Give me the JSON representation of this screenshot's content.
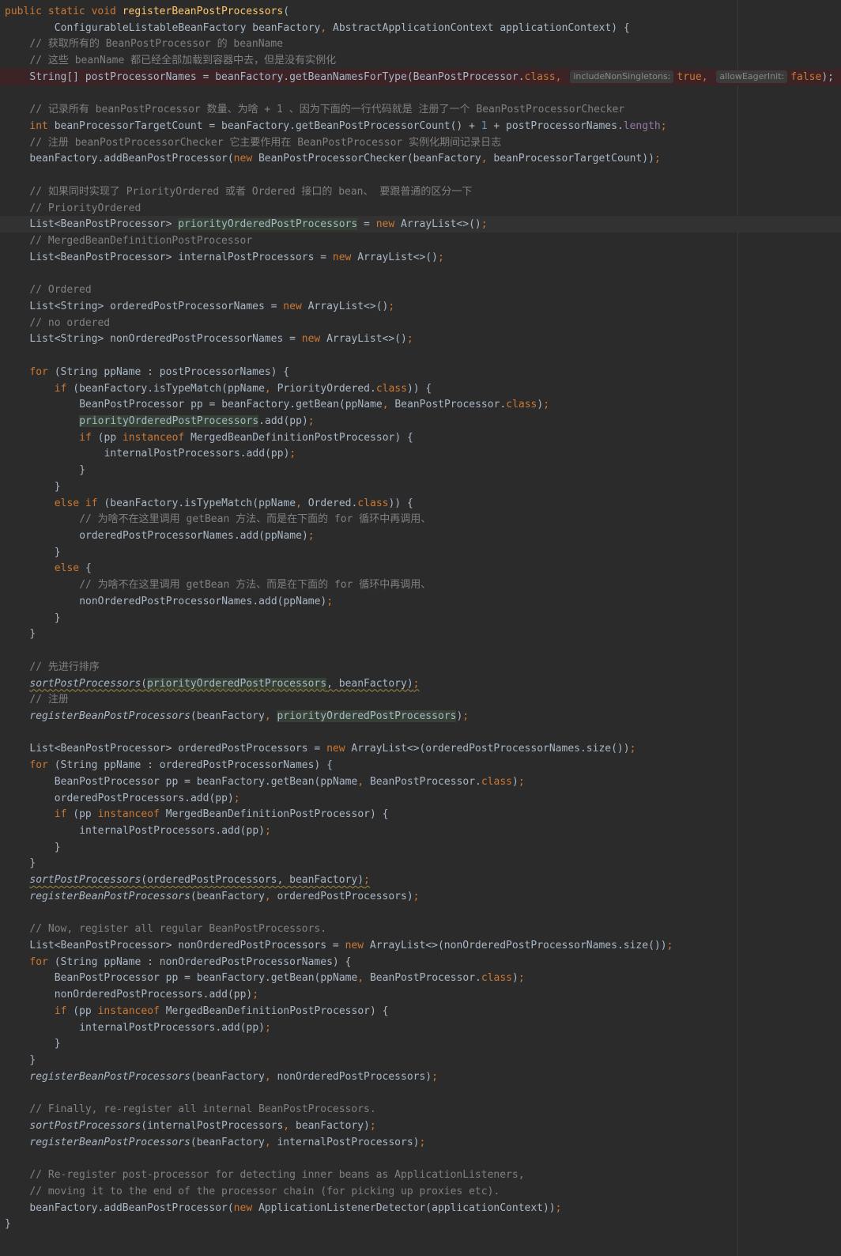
{
  "editor": {
    "colors": {
      "background": "#2b2b2b",
      "keyword": "#cc7832",
      "method_declaration": "#ffc66d",
      "comment": "#808080",
      "number": "#6897bb",
      "field": "#9876aa",
      "identifier": "#a9b7c6",
      "hint_background": "#3b3b3b",
      "error_line_background": "#3b2326"
    },
    "lines": [
      {
        "indent": 0,
        "tokens": [
          {
            "t": "public static void ",
            "c": "kw"
          },
          {
            "t": "registerBeanPostProcessors",
            "c": "fn"
          },
          {
            "t": "("
          }
        ]
      },
      {
        "indent": 8,
        "tokens": [
          {
            "t": "ConfigurableListableBeanFactory beanFactory"
          },
          {
            "t": ", ",
            "c": "kw"
          },
          {
            "t": "AbstractApplicationContext applicationContext) {"
          }
        ]
      },
      {
        "indent": 4,
        "tokens": [
          {
            "t": "// 获取所有的 BeanPostProcessor 的 beanName",
            "c": "comment"
          }
        ]
      },
      {
        "indent": 4,
        "tokens": [
          {
            "t": "// 这些 beanName 都已经全部加载到容器中去，但是没有实例化",
            "c": "comment"
          }
        ]
      },
      {
        "indent": 4,
        "bg": "err",
        "tokens": [
          {
            "t": "String[] postProcessorNames = beanFactory.getBeanNamesForType(BeanPostProcessor."
          },
          {
            "t": "class",
            "c": "kw"
          },
          {
            "t": ", ",
            "c": "kw"
          },
          {
            "t": "includeNonSingletons:",
            "c": "hint"
          },
          {
            "t": "true",
            "c": "kw"
          },
          {
            "t": ", ",
            "c": "kw"
          },
          {
            "t": "allowEagerInit:",
            "c": "hint"
          },
          {
            "t": "false",
            "c": "kw"
          },
          {
            "t": ");"
          }
        ]
      },
      {
        "indent": 0,
        "tokens": []
      },
      {
        "indent": 4,
        "tokens": [
          {
            "t": "// 记录所有 beanPostProcessor 数量、为啥 + 1 、因为下面的一行代码就是 注册了一个 BeanPostProcessorChecker",
            "c": "comment"
          }
        ]
      },
      {
        "indent": 4,
        "tokens": [
          {
            "t": "int ",
            "c": "kw"
          },
          {
            "t": "beanProcessorTargetCount = beanFactory.getBeanPostProcessorCount() + "
          },
          {
            "t": "1",
            "c": "num"
          },
          {
            "t": " + postProcessorNames."
          },
          {
            "t": "length",
            "c": "field"
          },
          {
            "t": ";",
            "c": "kw"
          }
        ]
      },
      {
        "indent": 4,
        "tokens": [
          {
            "t": "// 注册 beanPostProcessorChecker 它主要作用在 BeanPostProcessor 实例化期间记录日志",
            "c": "comment"
          }
        ]
      },
      {
        "indent": 4,
        "tokens": [
          {
            "t": "beanFactory.addBeanPostProcessor("
          },
          {
            "t": "new ",
            "c": "kw"
          },
          {
            "t": "BeanPostProcessorChecker(beanFactory"
          },
          {
            "t": ", ",
            "c": "kw"
          },
          {
            "t": "beanProcessorTargetCount))"
          },
          {
            "t": ";",
            "c": "kw"
          }
        ]
      },
      {
        "indent": 0,
        "tokens": []
      },
      {
        "indent": 4,
        "tokens": [
          {
            "t": "// 如果同时实现了 PriorityOrdered 或者 Ordered 接口的 bean、 要跟普通的区分一下",
            "c": "comment"
          }
        ]
      },
      {
        "indent": 4,
        "tokens": [
          {
            "t": "// PriorityOrdered",
            "c": "comment"
          }
        ]
      },
      {
        "indent": 4,
        "bg": "cur",
        "tokens": [
          {
            "t": "List<BeanPostProcessor> "
          },
          {
            "t": "priorityOrderedPostProcessors",
            "c": "hl"
          },
          {
            "t": " = "
          },
          {
            "t": "new ",
            "c": "kw"
          },
          {
            "t": "ArrayList<>()"
          },
          {
            "t": ";",
            "c": "kw"
          }
        ]
      },
      {
        "indent": 4,
        "tokens": [
          {
            "t": "// MergedBeanDefinitionPostProcessor",
            "c": "comment"
          }
        ]
      },
      {
        "indent": 4,
        "tokens": [
          {
            "t": "List<BeanPostProcessor> internalPostProcessors = "
          },
          {
            "t": "new ",
            "c": "kw"
          },
          {
            "t": "ArrayList<>()"
          },
          {
            "t": ";",
            "c": "kw"
          }
        ]
      },
      {
        "indent": 0,
        "tokens": []
      },
      {
        "indent": 4,
        "tokens": [
          {
            "t": "// Ordered",
            "c": "comment"
          }
        ]
      },
      {
        "indent": 4,
        "tokens": [
          {
            "t": "List<String> orderedPostProcessorNames = "
          },
          {
            "t": "new ",
            "c": "kw"
          },
          {
            "t": "ArrayList<>()"
          },
          {
            "t": ";",
            "c": "kw"
          }
        ]
      },
      {
        "indent": 4,
        "tokens": [
          {
            "t": "// no ordered",
            "c": "comment"
          }
        ]
      },
      {
        "indent": 4,
        "tokens": [
          {
            "t": "List<String> nonOrderedPostProcessorNames = "
          },
          {
            "t": "new ",
            "c": "kw"
          },
          {
            "t": "ArrayList<>()"
          },
          {
            "t": ";",
            "c": "kw"
          }
        ]
      },
      {
        "indent": 0,
        "tokens": []
      },
      {
        "indent": 4,
        "tokens": [
          {
            "t": "for ",
            "c": "kw"
          },
          {
            "t": "(String ppName : postProcessorNames) {"
          }
        ]
      },
      {
        "indent": 8,
        "tokens": [
          {
            "t": "if ",
            "c": "kw"
          },
          {
            "t": "(beanFactory.isTypeMatch(ppName"
          },
          {
            "t": ", ",
            "c": "kw"
          },
          {
            "t": "PriorityOrdered."
          },
          {
            "t": "class",
            "c": "kw"
          },
          {
            "t": ")) {"
          }
        ]
      },
      {
        "indent": 12,
        "tokens": [
          {
            "t": "BeanPostProcessor pp = beanFactory.getBean(ppName"
          },
          {
            "t": ", ",
            "c": "kw"
          },
          {
            "t": "BeanPostProcessor."
          },
          {
            "t": "class",
            "c": "kw"
          },
          {
            "t": ")"
          },
          {
            "t": ";",
            "c": "kw"
          }
        ]
      },
      {
        "indent": 12,
        "tokens": [
          {
            "t": "priorityOrderedPostProcessors",
            "c": "hl"
          },
          {
            "t": ".add(pp)"
          },
          {
            "t": ";",
            "c": "kw"
          }
        ]
      },
      {
        "indent": 12,
        "tokens": [
          {
            "t": "if ",
            "c": "kw"
          },
          {
            "t": "(pp "
          },
          {
            "t": "instanceof ",
            "c": "kw"
          },
          {
            "t": "MergedBeanDefinitionPostProcessor) {"
          }
        ]
      },
      {
        "indent": 16,
        "tokens": [
          {
            "t": "internalPostProcessors.add(pp)"
          },
          {
            "t": ";",
            "c": "kw"
          }
        ]
      },
      {
        "indent": 12,
        "tokens": [
          {
            "t": "}"
          }
        ]
      },
      {
        "indent": 8,
        "tokens": [
          {
            "t": "}"
          }
        ]
      },
      {
        "indent": 8,
        "tokens": [
          {
            "t": "else if ",
            "c": "kw"
          },
          {
            "t": "(beanFactory.isTypeMatch(ppName"
          },
          {
            "t": ", ",
            "c": "kw"
          },
          {
            "t": "Ordered."
          },
          {
            "t": "class",
            "c": "kw"
          },
          {
            "t": ")) {"
          }
        ]
      },
      {
        "indent": 12,
        "tokens": [
          {
            "t": "// 为啥不在这里调用 getBean 方法、而是在下面的 for 循环中再调用、",
            "c": "comment"
          }
        ]
      },
      {
        "indent": 12,
        "tokens": [
          {
            "t": "orderedPostProcessorNames.add(ppName)"
          },
          {
            "t": ";",
            "c": "kw"
          }
        ]
      },
      {
        "indent": 8,
        "tokens": [
          {
            "t": "}"
          }
        ]
      },
      {
        "indent": 8,
        "tokens": [
          {
            "t": "else ",
            "c": "kw"
          },
          {
            "t": "{"
          }
        ]
      },
      {
        "indent": 12,
        "tokens": [
          {
            "t": "// 为啥不在这里调用 getBean 方法、而是在下面的 for 循环中再调用、",
            "c": "comment"
          }
        ]
      },
      {
        "indent": 12,
        "tokens": [
          {
            "t": "nonOrderedPostProcessorNames.add(ppName)"
          },
          {
            "t": ";",
            "c": "kw"
          }
        ]
      },
      {
        "indent": 8,
        "tokens": [
          {
            "t": "}"
          }
        ]
      },
      {
        "indent": 4,
        "tokens": [
          {
            "t": "}"
          }
        ]
      },
      {
        "indent": 0,
        "tokens": []
      },
      {
        "indent": 4,
        "tokens": [
          {
            "t": "// 先进行排序",
            "c": "comment"
          }
        ]
      },
      {
        "indent": 4,
        "tokens": [
          {
            "t": "sortPostProcessors",
            "c": "static warn"
          },
          {
            "t": "(",
            "c": "warn"
          },
          {
            "t": "priorityOrderedPostProcessors",
            "c": "hl warn"
          },
          {
            "t": ", beanFactory)",
            "c": "warn"
          },
          {
            "t": ";",
            "c": "kw warn"
          }
        ]
      },
      {
        "indent": 4,
        "tokens": [
          {
            "t": "// 注册",
            "c": "comment"
          }
        ]
      },
      {
        "indent": 4,
        "tokens": [
          {
            "t": "registerBeanPostProcessors",
            "c": "static"
          },
          {
            "t": "(beanFactory"
          },
          {
            "t": ", ",
            "c": "kw"
          },
          {
            "t": "priorityOrderedPostProcessors",
            "c": "hl"
          },
          {
            "t": ")"
          },
          {
            "t": ";",
            "c": "kw"
          }
        ]
      },
      {
        "indent": 0,
        "tokens": []
      },
      {
        "indent": 4,
        "tokens": [
          {
            "t": "List<BeanPostProcessor> orderedPostProcessors = "
          },
          {
            "t": "new ",
            "c": "kw"
          },
          {
            "t": "ArrayList<>(orderedPostProcessorNames.size())"
          },
          {
            "t": ";",
            "c": "kw"
          }
        ]
      },
      {
        "indent": 4,
        "tokens": [
          {
            "t": "for ",
            "c": "kw"
          },
          {
            "t": "(String ppName : orderedPostProcessorNames) {"
          }
        ]
      },
      {
        "indent": 8,
        "tokens": [
          {
            "t": "BeanPostProcessor pp = beanFactory.getBean(ppName"
          },
          {
            "t": ", ",
            "c": "kw"
          },
          {
            "t": "BeanPostProcessor."
          },
          {
            "t": "class",
            "c": "kw"
          },
          {
            "t": ")"
          },
          {
            "t": ";",
            "c": "kw"
          }
        ]
      },
      {
        "indent": 8,
        "tokens": [
          {
            "t": "orderedPostProcessors.add(pp)"
          },
          {
            "t": ";",
            "c": "kw"
          }
        ]
      },
      {
        "indent": 8,
        "tokens": [
          {
            "t": "if ",
            "c": "kw"
          },
          {
            "t": "(pp "
          },
          {
            "t": "instanceof ",
            "c": "kw"
          },
          {
            "t": "MergedBeanDefinitionPostProcessor) {"
          }
        ]
      },
      {
        "indent": 12,
        "tokens": [
          {
            "t": "internalPostProcessors.add(pp)"
          },
          {
            "t": ";",
            "c": "kw"
          }
        ]
      },
      {
        "indent": 8,
        "tokens": [
          {
            "t": "}"
          }
        ]
      },
      {
        "indent": 4,
        "tokens": [
          {
            "t": "}"
          }
        ]
      },
      {
        "indent": 4,
        "tokens": [
          {
            "t": "sortPostProcessors",
            "c": "static warn"
          },
          {
            "t": "(orderedPostProcessors, beanFactory)",
            "c": "warn"
          },
          {
            "t": ";",
            "c": "kw warn"
          }
        ]
      },
      {
        "indent": 4,
        "tokens": [
          {
            "t": "registerBeanPostProcessors",
            "c": "static"
          },
          {
            "t": "(beanFactory"
          },
          {
            "t": ", ",
            "c": "kw"
          },
          {
            "t": "orderedPostProcessors)"
          },
          {
            "t": ";",
            "c": "kw"
          }
        ]
      },
      {
        "indent": 0,
        "tokens": []
      },
      {
        "indent": 4,
        "tokens": [
          {
            "t": "// Now, register all regular BeanPostProcessors.",
            "c": "comment"
          }
        ]
      },
      {
        "indent": 4,
        "tokens": [
          {
            "t": "List<BeanPostProcessor> nonOrderedPostProcessors = "
          },
          {
            "t": "new ",
            "c": "kw"
          },
          {
            "t": "ArrayList<>(nonOrderedPostProcessorNames.size())"
          },
          {
            "t": ";",
            "c": "kw"
          }
        ]
      },
      {
        "indent": 4,
        "tokens": [
          {
            "t": "for ",
            "c": "kw"
          },
          {
            "t": "(String ppName : nonOrderedPostProcessorNames) {"
          }
        ]
      },
      {
        "indent": 8,
        "tokens": [
          {
            "t": "BeanPostProcessor pp = beanFactory.getBean(ppName"
          },
          {
            "t": ", ",
            "c": "kw"
          },
          {
            "t": "BeanPostProcessor."
          },
          {
            "t": "class",
            "c": "kw"
          },
          {
            "t": ")"
          },
          {
            "t": ";",
            "c": "kw"
          }
        ]
      },
      {
        "indent": 8,
        "tokens": [
          {
            "t": "nonOrderedPostProcessors.add(pp)"
          },
          {
            "t": ";",
            "c": "kw"
          }
        ]
      },
      {
        "indent": 8,
        "tokens": [
          {
            "t": "if ",
            "c": "kw"
          },
          {
            "t": "(pp "
          },
          {
            "t": "instanceof ",
            "c": "kw"
          },
          {
            "t": "MergedBeanDefinitionPostProcessor) {"
          }
        ]
      },
      {
        "indent": 12,
        "tokens": [
          {
            "t": "internalPostProcessors.add(pp)"
          },
          {
            "t": ";",
            "c": "kw"
          }
        ]
      },
      {
        "indent": 8,
        "tokens": [
          {
            "t": "}"
          }
        ]
      },
      {
        "indent": 4,
        "tokens": [
          {
            "t": "}"
          }
        ]
      },
      {
        "indent": 4,
        "tokens": [
          {
            "t": "registerBeanPostProcessors",
            "c": "static"
          },
          {
            "t": "(beanFactory"
          },
          {
            "t": ", ",
            "c": "kw"
          },
          {
            "t": "nonOrderedPostProcessors)"
          },
          {
            "t": ";",
            "c": "kw"
          }
        ]
      },
      {
        "indent": 0,
        "tokens": []
      },
      {
        "indent": 4,
        "tokens": [
          {
            "t": "// Finally, re-register all internal BeanPostProcessors.",
            "c": "comment"
          }
        ]
      },
      {
        "indent": 4,
        "tokens": [
          {
            "t": "sortPostProcessors",
            "c": "static"
          },
          {
            "t": "(internalPostProcessors"
          },
          {
            "t": ", ",
            "c": "kw"
          },
          {
            "t": "beanFactory)"
          },
          {
            "t": ";",
            "c": "kw"
          }
        ]
      },
      {
        "indent": 4,
        "tokens": [
          {
            "t": "registerBeanPostProcessors",
            "c": "static"
          },
          {
            "t": "(beanFactory"
          },
          {
            "t": ", ",
            "c": "kw"
          },
          {
            "t": "internalPostProcessors)"
          },
          {
            "t": ";",
            "c": "kw"
          }
        ]
      },
      {
        "indent": 0,
        "tokens": []
      },
      {
        "indent": 4,
        "tokens": [
          {
            "t": "// Re-register post-processor for detecting inner beans as ApplicationListeners,",
            "c": "comment"
          }
        ]
      },
      {
        "indent": 4,
        "tokens": [
          {
            "t": "// moving it to the end of the processor chain (for picking up proxies etc).",
            "c": "comment"
          }
        ]
      },
      {
        "indent": 4,
        "tokens": [
          {
            "t": "beanFactory.addBeanPostProcessor("
          },
          {
            "t": "new ",
            "c": "kw"
          },
          {
            "t": "ApplicationListenerDetector(applicationContext))"
          },
          {
            "t": ";",
            "c": "kw"
          }
        ]
      },
      {
        "indent": 0,
        "tokens": [
          {
            "t": "}"
          }
        ]
      }
    ]
  }
}
